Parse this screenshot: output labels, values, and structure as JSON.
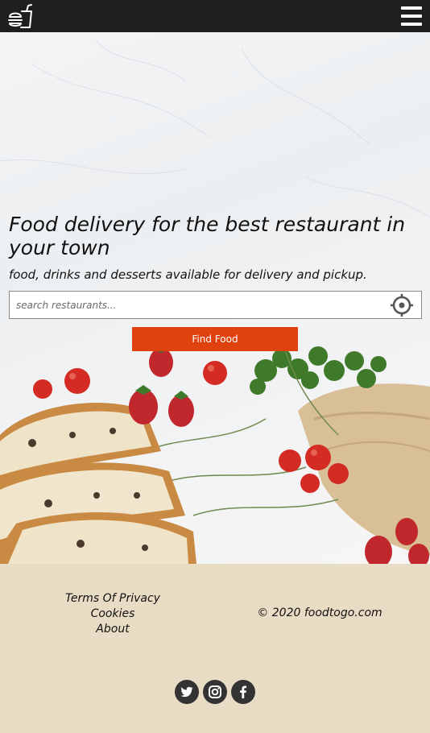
{
  "header": {
    "logo_icon": "burger-drink-icon",
    "menu_icon": "hamburger-menu-icon"
  },
  "hero": {
    "headline": "Food delivery for the best restaurant in your town",
    "subline": "food, drinks and desserts available for delivery and pickup.",
    "search": {
      "placeholder": "search restaurants...",
      "value": "",
      "locate_icon": "crosshair-location-icon"
    },
    "find_button": "Find Food"
  },
  "footer": {
    "links": [
      "Terms Of Privacy",
      "Cookies",
      "About"
    ],
    "copyright": "© 2020 foodtogo.com",
    "social": [
      "twitter-icon",
      "instagram-icon",
      "facebook-icon"
    ]
  },
  "colors": {
    "topbar": "#1f1f1f",
    "button": "#e0420f",
    "footer": "#e9dcc4",
    "social_bg": "#333333"
  }
}
